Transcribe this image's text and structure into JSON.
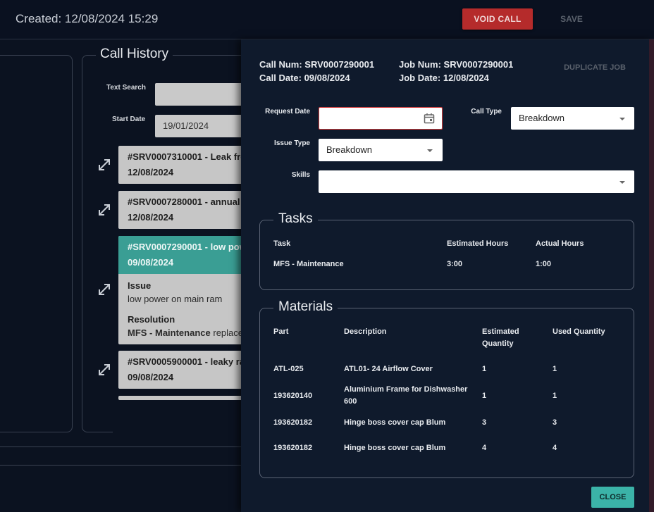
{
  "header": {
    "created": "Created: 12/08/2024 15:29",
    "void_label": "VOID CALL",
    "save_label": "SAVE"
  },
  "call_history": {
    "title": "Call History",
    "text_search_label": "Text Search",
    "text_search_value": "",
    "start_date_label": "Start Date",
    "start_date_value": "19/01/2024",
    "calls": [
      {
        "title": "#SRV0007310001 - Leak fro",
        "date": "12/08/2024"
      },
      {
        "title": "#SRV0007280001 - annual",
        "date": "12/08/2024"
      },
      {
        "title": "#SRV0007290001 - low pow",
        "date": "09/08/2024",
        "issue_label": "Issue",
        "issue": "low power on main ram",
        "resolution_label": "Resolution",
        "resolution_bold": "MFS - Maintenance",
        "resolution_text": " replace"
      },
      {
        "title": "#SRV0005900001 - leaky ra",
        "date": "09/08/2024"
      }
    ]
  },
  "modal": {
    "call_num": "Call Num: SRV0007290001",
    "call_date": "Call Date: 09/08/2024",
    "job_num": "Job Num: SRV0007290001",
    "job_date": "Job Date: 12/08/2024",
    "duplicate_label": "DUPLICATE JOB",
    "request_date_label": "Request Date",
    "request_date_value": "",
    "call_type_label": "Call Type",
    "call_type_value": "Breakdown",
    "issue_type_label": "Issue Type",
    "issue_type_value": "Breakdown",
    "skills_label": "Skills",
    "skills_value": "",
    "tasks": {
      "title": "Tasks",
      "headers": [
        "Task",
        "Estimated Hours",
        "Actual Hours"
      ],
      "rows": [
        [
          "MFS - Maintenance",
          "3:00",
          "1:00"
        ]
      ]
    },
    "materials": {
      "title": "Materials",
      "headers": [
        "Part",
        "Description",
        "Estimated Quantity",
        "Used Quantity"
      ],
      "rows": [
        [
          "ATL-025",
          "ATL01- 24 Airflow Cover",
          "1",
          "1"
        ],
        [
          "193620140",
          "Aluminium Frame for Dishwasher 600",
          "1",
          "1"
        ],
        [
          "193620182",
          "Hinge boss cover cap Blum",
          "3",
          "3"
        ],
        [
          "193620182",
          "Hinge boss cover cap Blum",
          "4",
          "4"
        ]
      ]
    },
    "close_label": "CLOSE"
  },
  "colors": {
    "void": "#b52b2b",
    "accent": "#3bb3a8",
    "active_card": "#3a9e94",
    "error": "#d23a3a"
  }
}
